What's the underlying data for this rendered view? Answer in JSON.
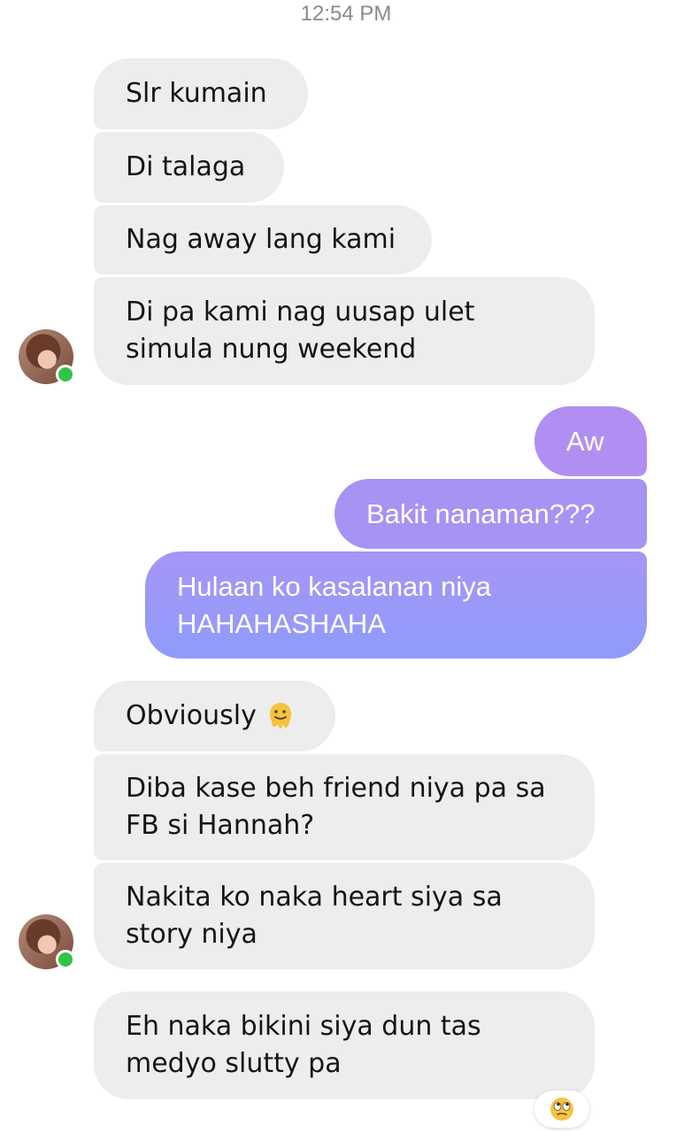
{
  "conversation": {
    "timestamp": "12:54 PM",
    "messages": [
      {
        "direction": "incoming",
        "lines": [
          "Slr kumain"
        ]
      },
      {
        "direction": "incoming",
        "lines": [
          "Di talaga"
        ]
      },
      {
        "direction": "incoming",
        "lines": [
          "Nag away lang kami"
        ]
      },
      {
        "direction": "incoming",
        "lines": [
          "Di pa kami nag uusap ulet",
          "simula nung weekend"
        ]
      },
      {
        "direction": "outgoing",
        "lines": [
          "Aw"
        ]
      },
      {
        "direction": "outgoing",
        "lines": [
          "Bakit nanaman???"
        ]
      },
      {
        "direction": "outgoing",
        "lines": [
          "Hulaan ko kasalanan niya",
          "HAHAHASHAHA"
        ]
      },
      {
        "direction": "incoming",
        "lines": [
          "Obviously"
        ],
        "emoji": "melting-face-emoji"
      },
      {
        "direction": "incoming",
        "lines": [
          "Diba kase beh friend niya pa sa",
          "FB si Hannah?"
        ]
      },
      {
        "direction": "incoming",
        "lines": [
          "Nakita ko naka heart siya sa",
          "story niya"
        ]
      },
      {
        "direction": "incoming",
        "lines": [
          "Eh naka bikini siya dun tas",
          "medyo slutty pa"
        ],
        "reaction": "eye-roll-emoji"
      }
    ]
  },
  "theme": {
    "incoming_bubble": "#ededed",
    "outgoing_gradient_start": "#b38ef2",
    "outgoing_gradient_end": "#8a9ffb",
    "online_indicator": "#31c34a"
  }
}
